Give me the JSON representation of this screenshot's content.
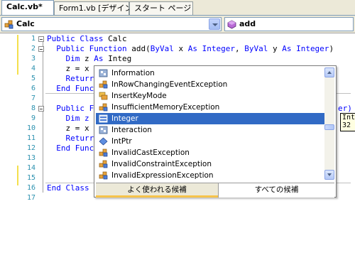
{
  "tabs": [
    {
      "label": "Calc.vb*",
      "active": true
    },
    {
      "label": "Form1.vb [デザイン]",
      "active": false
    },
    {
      "label": "スタート ページ",
      "active": false
    }
  ],
  "combos": {
    "class_combo": {
      "value": "Calc",
      "icon": "class-icon"
    },
    "member_combo": {
      "value": "add",
      "icon": "method-icon"
    }
  },
  "line_numbers": [
    "1",
    "2",
    "3",
    "4",
    "5",
    "6",
    "7",
    "8",
    "9",
    "10",
    "11",
    "12",
    "13",
    "14",
    "15",
    "16",
    "17"
  ],
  "code": {
    "l1a": "Public Class",
    "l1b": " Calc",
    "l2a": "  Public Function",
    "l2b": " add(",
    "l2c": "ByVal",
    "l2d": " x ",
    "l2e": "As Integer",
    "l2f": ", ",
    "l2g": "ByVal",
    "l2h": " y ",
    "l2i": "As Integer",
    "l2j": ")",
    "l3a": "    Dim",
    "l3b": " z ",
    "l3c": "As",
    "l3d": " Integ",
    "l4": "    z = x",
    "l5": "    Returr",
    "l6": "  End Func",
    "l8a": "  Public F",
    "l8b": "er)",
    "l9": "    Dim z",
    "l10": "    z = x",
    "l11": "    Returr",
    "l12": "  End Func",
    "l16": "End Class"
  },
  "completion": {
    "items": [
      {
        "label": "Information",
        "icon": "module-icon",
        "selected": false
      },
      {
        "label": "InRowChangingEventException",
        "icon": "class-icon",
        "selected": false
      },
      {
        "label": "InsertKeyMode",
        "icon": "enum-icon",
        "selected": false
      },
      {
        "label": "InsufficientMemoryException",
        "icon": "class-icon",
        "selected": false
      },
      {
        "label": "Integer",
        "icon": "structure-icon",
        "selected": true
      },
      {
        "label": "Interaction",
        "icon": "module-icon",
        "selected": false
      },
      {
        "label": "IntPtr",
        "icon": "structure-icon",
        "selected": false
      },
      {
        "label": "InvalidCastException",
        "icon": "class-icon",
        "selected": false
      },
      {
        "label": "InvalidConstraintException",
        "icon": "class-icon",
        "selected": false
      },
      {
        "label": "InvalidExpressionException",
        "icon": "class-icon",
        "selected": false
      }
    ],
    "tab_common": "よく使われる候補",
    "tab_all": "すべての候補"
  },
  "tooltip": {
    "line1": "Inte",
    "line2": "32"
  },
  "colors": {
    "keyword": "#0000ff",
    "line_number": "#2b91af",
    "selection": "#316ac5",
    "tooltip_bg": "#ffffe1"
  }
}
